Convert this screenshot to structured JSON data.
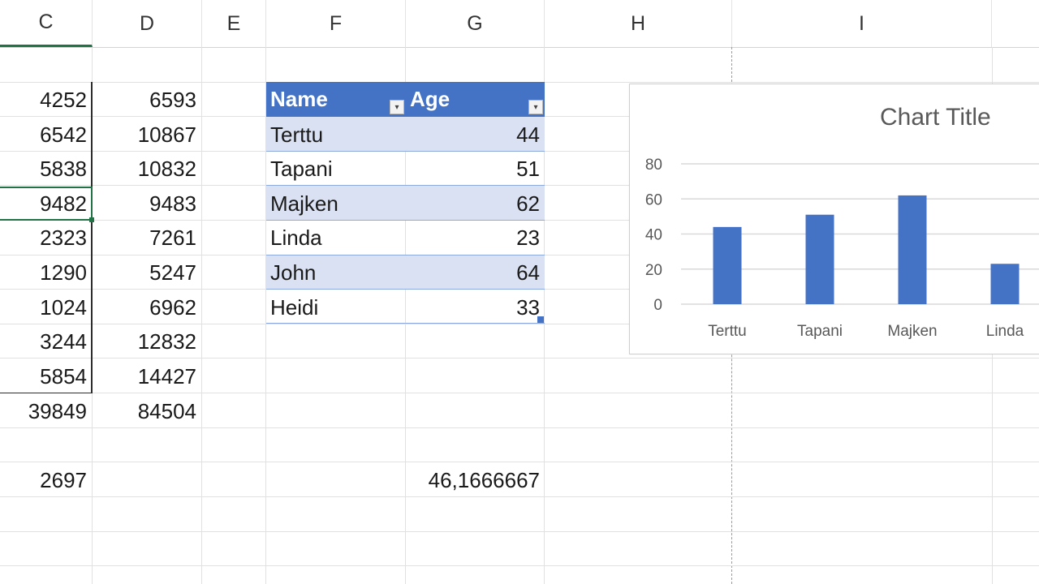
{
  "columns": [
    "C",
    "D",
    "E",
    "F",
    "G",
    "H",
    "I"
  ],
  "col_c_values": [
    "4252",
    "6542",
    "5838",
    "9482",
    "2323",
    "1290",
    "1024",
    "3244",
    "5854",
    "39849",
    "",
    "2697"
  ],
  "col_d_values": [
    "6593",
    "10867",
    "10832",
    "9483",
    "7261",
    "5247",
    "6962",
    "12832",
    "14427",
    "84504",
    "",
    ""
  ],
  "table": {
    "headers": [
      "Name",
      "Age"
    ],
    "rows": [
      {
        "name": "Terttu",
        "age": "44"
      },
      {
        "name": "Tapani",
        "age": "51"
      },
      {
        "name": "Majken",
        "age": "62"
      },
      {
        "name": "Linda",
        "age": "23"
      },
      {
        "name": "John",
        "age": "64"
      },
      {
        "name": "Heidi",
        "age": "33"
      }
    ],
    "header_color": "#4472c4",
    "band_color": "#d9e1f2"
  },
  "average_value": "46,1666667",
  "chart_data": {
    "type": "bar",
    "title": "Chart Title",
    "categories": [
      "Terttu",
      "Tapani",
      "Majken",
      "Linda"
    ],
    "values": [
      44,
      51,
      62,
      23
    ],
    "ylim": [
      0,
      80
    ],
    "yticks": [
      "0",
      "20",
      "40",
      "60",
      "80"
    ],
    "grid": true,
    "bar_color": "#4472c4"
  }
}
